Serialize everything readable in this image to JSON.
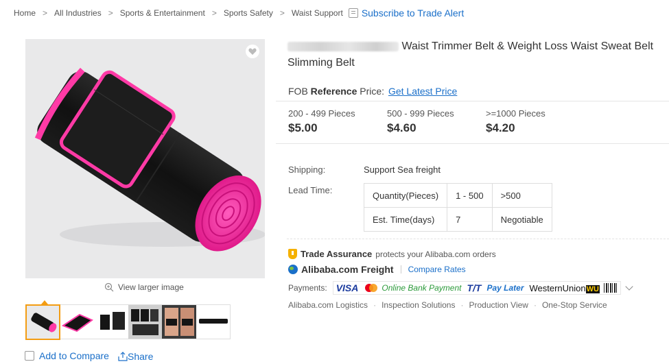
{
  "breadcrumb": {
    "items": [
      "Home",
      "All Industries",
      "Sports & Entertainment",
      "Sports Safety",
      "Waist Support"
    ],
    "separator": ">",
    "alert_label": "Subscribe to Trade Alert"
  },
  "product": {
    "title_suffix": "Waist Trimmer Belt & Weight Loss Waist Sweat Belt",
    "title_line2": "Slimming Belt",
    "fob_prefix": "FOB",
    "fob_reference": "Reference",
    "fob_suffix": "Price:",
    "fob_link": "Get Latest Price",
    "tiers": [
      {
        "qty": "200 - 499 Pieces",
        "price": "$5.00"
      },
      {
        "qty": "500 - 999 Pieces",
        "price": "$4.60"
      },
      {
        "qty": ">=1000 Pieces",
        "price": "$4.20"
      }
    ]
  },
  "shipping": {
    "label": "Shipping:",
    "value": "Support Sea freight"
  },
  "lead_time": {
    "label": "Lead Time:",
    "rows": [
      [
        "Quantity(Pieces)",
        "1 - 500",
        ">500"
      ],
      [
        "Est. Time(days)",
        "7",
        "Negotiable"
      ]
    ]
  },
  "trade_assurance": {
    "title": "Trade Assurance",
    "text": "protects your Alibaba.com orders"
  },
  "freight": {
    "title": "Alibaba.com Freight",
    "link": "Compare Rates"
  },
  "payments": {
    "label": "Payments:",
    "visa": "VISA",
    "online_bank": "Online Bank Payment",
    "tt": "T/T",
    "pay_later": "Pay Later",
    "western_union": "WesternUnion",
    "wu": "WU"
  },
  "services": [
    "Alibaba.com Logistics",
    "Inspection Solutions",
    "Production View",
    "One-Stop Service"
  ],
  "gallery": {
    "view_larger": "View larger image",
    "add_to_compare": "Add to Compare",
    "share": "Share"
  },
  "colors": {
    "link": "#1a6fc9",
    "active_thumb": "#f39c12",
    "belt_black": "#151515",
    "belt_pink": "#ff3aa6"
  }
}
